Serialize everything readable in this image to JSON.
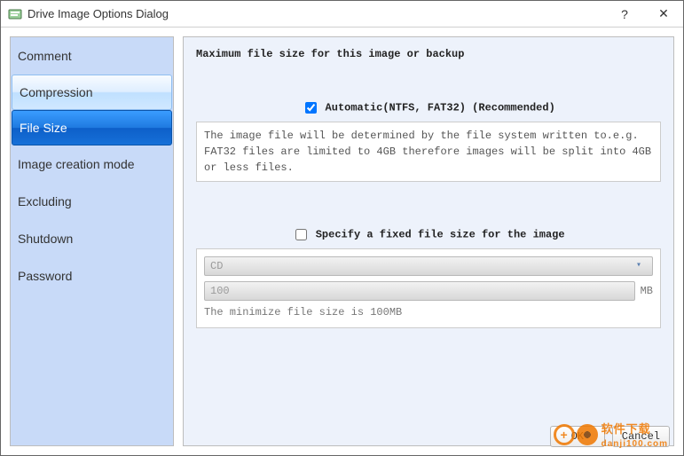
{
  "window": {
    "title": "Drive Image Options Dialog"
  },
  "sidebar": {
    "items": [
      {
        "label": "Comment",
        "state": "normal"
      },
      {
        "label": "Compression",
        "state": "hovered"
      },
      {
        "label": "File Size",
        "state": "selected"
      },
      {
        "label": "Image creation mode",
        "state": "normal"
      },
      {
        "label": "Excluding",
        "state": "normal"
      },
      {
        "label": "Shutdown",
        "state": "normal"
      },
      {
        "label": "Password",
        "state": "normal"
      }
    ]
  },
  "content": {
    "heading": "Maximum file size for this image or backup",
    "automatic": {
      "checked": true,
      "label": "Automatic(NTFS, FAT32) (Recommended)",
      "info": "The image file will be determined by the file system written to.e.g. FAT32 files are limited to 4GB therefore images will be  split into 4GB or less files."
    },
    "fixed": {
      "checked": false,
      "label": "Specify a fixed file size for the image",
      "media_value": "CD",
      "size_value": "100",
      "size_unit": "MB",
      "note": "The minimize file size is 100MB"
    }
  },
  "footer": {
    "ok": "OK",
    "cancel": "Cancel"
  },
  "watermark": {
    "text": "软件下载",
    "url": "danji100.com"
  }
}
